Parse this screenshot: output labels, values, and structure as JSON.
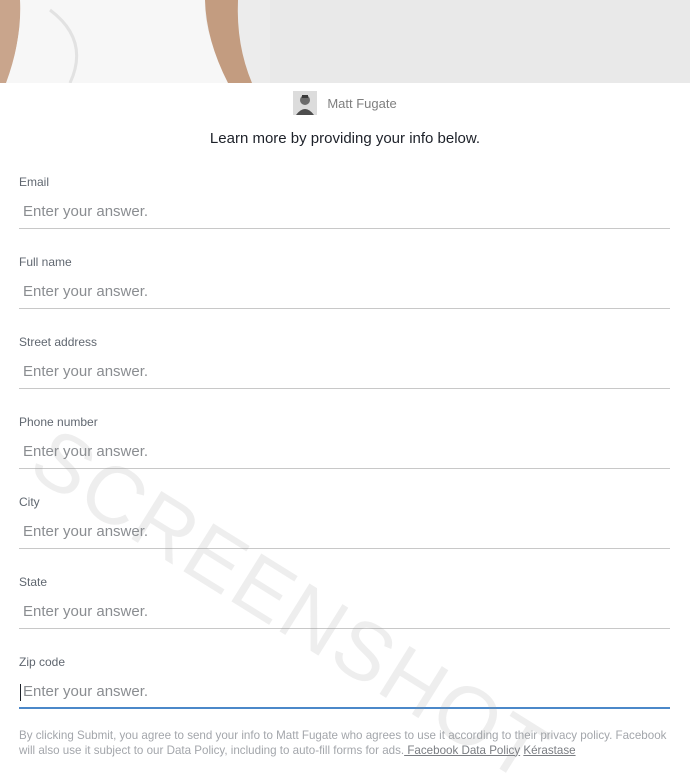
{
  "advertiser": {
    "name": "Matt Fugate"
  },
  "intro_text": "Learn more by providing your info below.",
  "fields": [
    {
      "label": "Email",
      "placeholder": "Enter your answer."
    },
    {
      "label": "Full name",
      "placeholder": "Enter your answer."
    },
    {
      "label": "Street address",
      "placeholder": "Enter your answer."
    },
    {
      "label": "Phone number",
      "placeholder": "Enter your answer."
    },
    {
      "label": "City",
      "placeholder": "Enter your answer."
    },
    {
      "label": "State",
      "placeholder": "Enter your answer."
    },
    {
      "label": "Zip code",
      "placeholder": "Enter your answer."
    }
  ],
  "disclaimer": {
    "text": "By clicking Submit, you agree to send your info to Matt Fugate who agrees to use it according to their privacy policy. Facebook will also use it subject to our Data Policy, including to auto-fill forms for ads.",
    "data_policy_link": " Facebook Data Policy",
    "brand_link": "Kérastase"
  },
  "watermark": "SCREENSHOT",
  "colors": {
    "active_underline": "#4b88c9",
    "placeholder": "#8a8d91",
    "label": "#606770"
  }
}
